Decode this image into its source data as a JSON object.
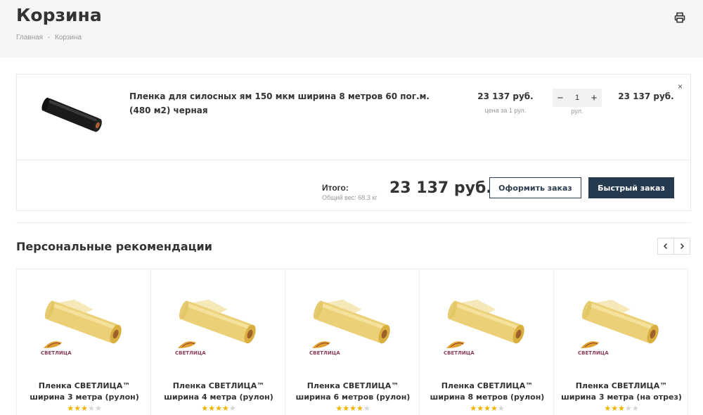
{
  "header": {
    "title": "Корзина",
    "breadcrumb": [
      "Главная",
      "-",
      "Корзина"
    ],
    "print_icon": "printer-icon"
  },
  "cart": {
    "item": {
      "name": "Пленка для силосных ям 150 мкм ширина 8 метров 60 пог.м. (480 м2) черная",
      "price": "23 137 руб.",
      "price_note": "цена за 1 рул.",
      "qty_minus": "−",
      "qty": "1",
      "qty_plus": "+",
      "qty_unit": "рул.",
      "line_total": "23 137 руб.",
      "remove": "×",
      "image_icon": "black-film-roll-image"
    },
    "total_label": "Итого:",
    "weight": "Общий вес: 68.3 кг",
    "total_sum": "23 137 руб.",
    "order_button": "Оформить заказ",
    "fast_order_button": "Быстрый заказ"
  },
  "recommendations": {
    "title": "Персональные рекомендации",
    "prev": "‹",
    "next": "›",
    "products": [
      {
        "name": "Пленка СВЕТЛИЦА™ ширина 3 метра (рулон)",
        "rating": 3
      },
      {
        "name": "Пленка СВЕТЛИЦА™ ширина 4 метра (рулон)",
        "rating": 4
      },
      {
        "name": "Пленка СВЕТЛИЦА™ ширина 6 метров (рулон)",
        "rating": 4
      },
      {
        "name": "Пленка СВЕТЛИЦА™ ширина 8 метров (рулон)",
        "rating": 4
      },
      {
        "name": "Пленка СВЕТЛИЦА™ ширина 3 метра (на отрез)",
        "rating": 3
      }
    ],
    "logo_text": "СВЕТЛИЦА"
  },
  "colors": {
    "header_bg": "#f5f5f5",
    "button_dark": "#263a4f",
    "star": "#f0b400",
    "roll_yellow": "#e8c860"
  }
}
